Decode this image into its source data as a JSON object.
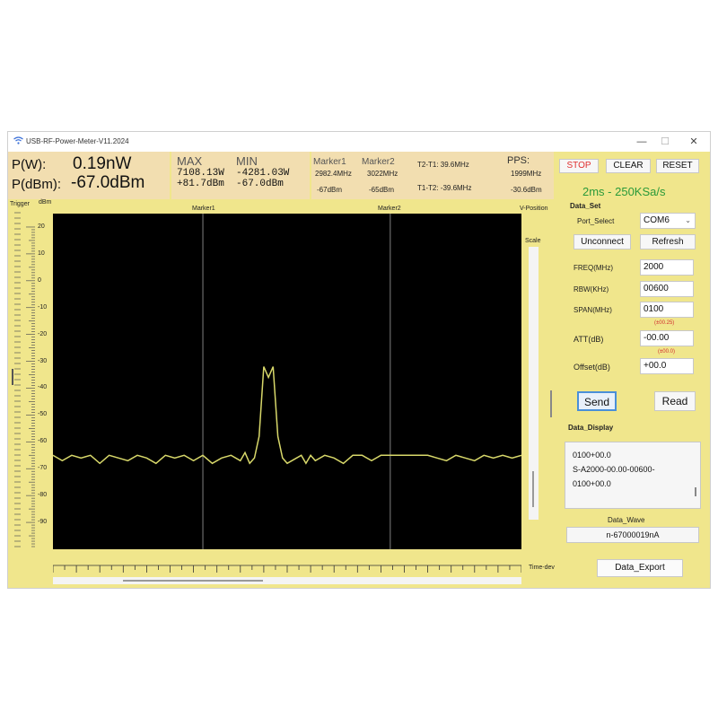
{
  "window": {
    "title": "USB-RF-Power-Meter-V11.2024",
    "minimize": "—",
    "maximize": "☐",
    "close": "✕"
  },
  "readout": {
    "pw_label": "P(W):",
    "pw_value": "0.19nW",
    "pdbm_label": "P(dBm):",
    "pdbm_value": "-67.0dBm",
    "max_label": "MAX",
    "max_w": "7108.13W",
    "max_dbm": "+81.7dBm",
    "min_label": "MIN",
    "min_w": "-4281.03W",
    "min_dbm": "-67.0dBm",
    "marker1_label": "Marker1",
    "marker1_freq": "2982.4MHz",
    "marker1_dbm": "-67dBm",
    "marker2_label": "Marker2",
    "marker2_freq": "3022MHz",
    "marker2_dbm": "-65dBm",
    "t2t1": "T2-T1: 39.6MHz",
    "t1t2": "T1-T2: -39.6MHz",
    "pps_label": "PPS:",
    "pps_freq": "1999MHz",
    "pps_dbm": "-30.6dBm"
  },
  "plot": {
    "trigger_label": "Trigger",
    "unit_label": "dBm",
    "marker1": "Marker1",
    "marker2": "Marker2",
    "vposition_label": "V-Position",
    "scale_label": "Scale",
    "timedev_label": "Time-dev",
    "y_ticks": [
      "20",
      "10",
      "0",
      "-10",
      "-20",
      "-30",
      "-40",
      "-50",
      "-60",
      "-70",
      "-80",
      "-90"
    ],
    "trace_color": "#d8d86a",
    "marker_line_color": "#808080"
  },
  "chart_data": {
    "type": "line",
    "ylabel": "dBm",
    "ylim": [
      25,
      -100
    ],
    "xlim": [
      1950,
      2050
    ],
    "marker1_x": 1982,
    "marker2_x": 2022,
    "x": [
      1950,
      1952,
      1954,
      1956,
      1958,
      1960,
      1962,
      1964,
      1966,
      1968,
      1970,
      1972,
      1974,
      1976,
      1978,
      1980,
      1982,
      1984,
      1986,
      1988,
      1990,
      1991,
      1992,
      1993,
      1994,
      1995,
      1996,
      1997,
      1998,
      1999,
      2000,
      2001,
      2002,
      2003,
      2004,
      2005,
      2006,
      2008,
      2010,
      2012,
      2014,
      2016,
      2018,
      2020,
      2022,
      2024,
      2026,
      2028,
      2030,
      2032,
      2034,
      2036,
      2038,
      2040,
      2042,
      2044,
      2046,
      2048,
      2050
    ],
    "series": [
      {
        "values": [
          -65,
          -67,
          -65,
          -66,
          -65,
          -68,
          -65,
          -66,
          -67,
          -65,
          -66,
          -68,
          -65,
          -66,
          -65,
          -67,
          -65,
          -68,
          -66,
          -65,
          -67,
          -64,
          -68,
          -66,
          -58,
          -32,
          -36,
          -32,
          -58,
          -66,
          -68,
          -67,
          -66,
          -65,
          -68,
          -65,
          -67,
          -65,
          -66,
          -68,
          -65,
          -65,
          -67,
          -65,
          -65,
          -65,
          -65,
          -65,
          -65,
          -66,
          -67,
          -65,
          -66,
          -67,
          -65,
          -66,
          -65,
          -66,
          -65
        ]
      }
    ]
  },
  "controls": {
    "stop": "STOP",
    "clear": "CLEAR",
    "reset": "RESET",
    "rate": "2ms - 250KSa/s",
    "data_set_label": "Data_Set",
    "port_select_label": "Port_Select",
    "port_value": "COM6",
    "unconnect": "Unconnect",
    "refresh": "Refresh",
    "freq_label": "FREQ(MHz)",
    "freq_value": "2000",
    "rbw_label": "RBW(KHz)",
    "rbw_value": "00600",
    "span_label": "SPAN(MHz)",
    "span_value": "0100",
    "att_hint": "(±00.25)",
    "att_label": "ATT(dB)",
    "att_value": "-00.00",
    "offset_hint": "(±00.0)",
    "offset_label": "Offset(dB)",
    "offset_value": "+00.0",
    "send": "Send",
    "read": "Read",
    "data_display_label": "Data_Display",
    "data_display_line1": "0100+00.0",
    "data_display_line2": "S-A2000-00.00-00600-",
    "data_display_line3": "0100+00.0",
    "data_wave_label": "Data_Wave",
    "data_wave_value": "n-67000019nA",
    "data_export": "Data_Export",
    "stop_color": "#e03030",
    "rate_color": "#2a9a3a"
  }
}
